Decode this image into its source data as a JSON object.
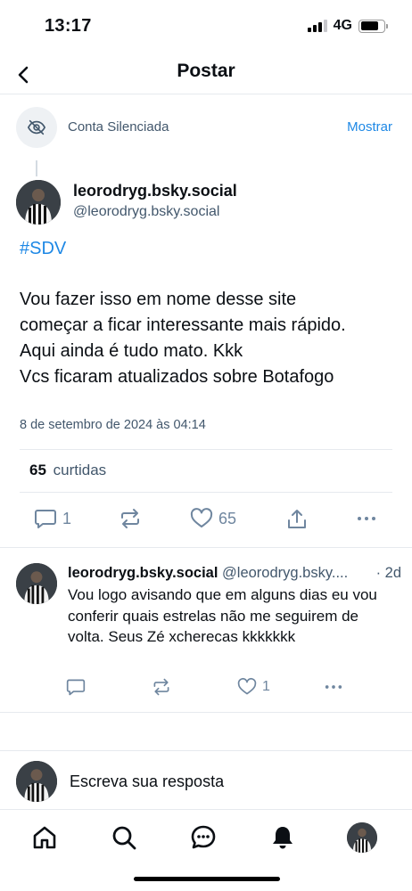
{
  "status_bar": {
    "time": "13:17",
    "network": "4G"
  },
  "header": {
    "title": "Postar"
  },
  "muted_notice": {
    "label": "Conta Silenciada",
    "action": "Mostrar"
  },
  "post": {
    "display_name": "leorodryg.bsky.social",
    "handle": "@leorodryg.bsky.social",
    "hashtag": "#SDV",
    "lines": [
      "Vou fazer isso em nome desse site",
      "começar a ficar interessante mais rápido.",
      "Aqui ainda é tudo mato. Kkk",
      "Vcs ficaram atualizados sobre Botafogo"
    ],
    "timestamp": "8 de setembro de 2024 às 04:14",
    "like_count": "65",
    "like_label": "curtidas",
    "actions": {
      "reply_count": "1",
      "like_count": "65"
    }
  },
  "reply": {
    "display_name": "leorodryg.bsky.social",
    "handle": "@leorodryg.bsky....",
    "time": "· 2d",
    "text": "Vou logo avisando que em alguns dias eu vou conferir quais estrelas não me seguirem de volta. Seus Zé xcherecas kkkkkkk",
    "actions": {
      "reply_count": "",
      "like_count": "1"
    }
  },
  "compose": {
    "placeholder": "Escreva sua resposta"
  },
  "nav": [
    "home-icon",
    "search-icon",
    "chat-icon",
    "bell-icon",
    "profile-avatar"
  ],
  "colors": {
    "accent": "#1e88e5",
    "muted_text": "#42576c",
    "icon": "#6f869f"
  }
}
